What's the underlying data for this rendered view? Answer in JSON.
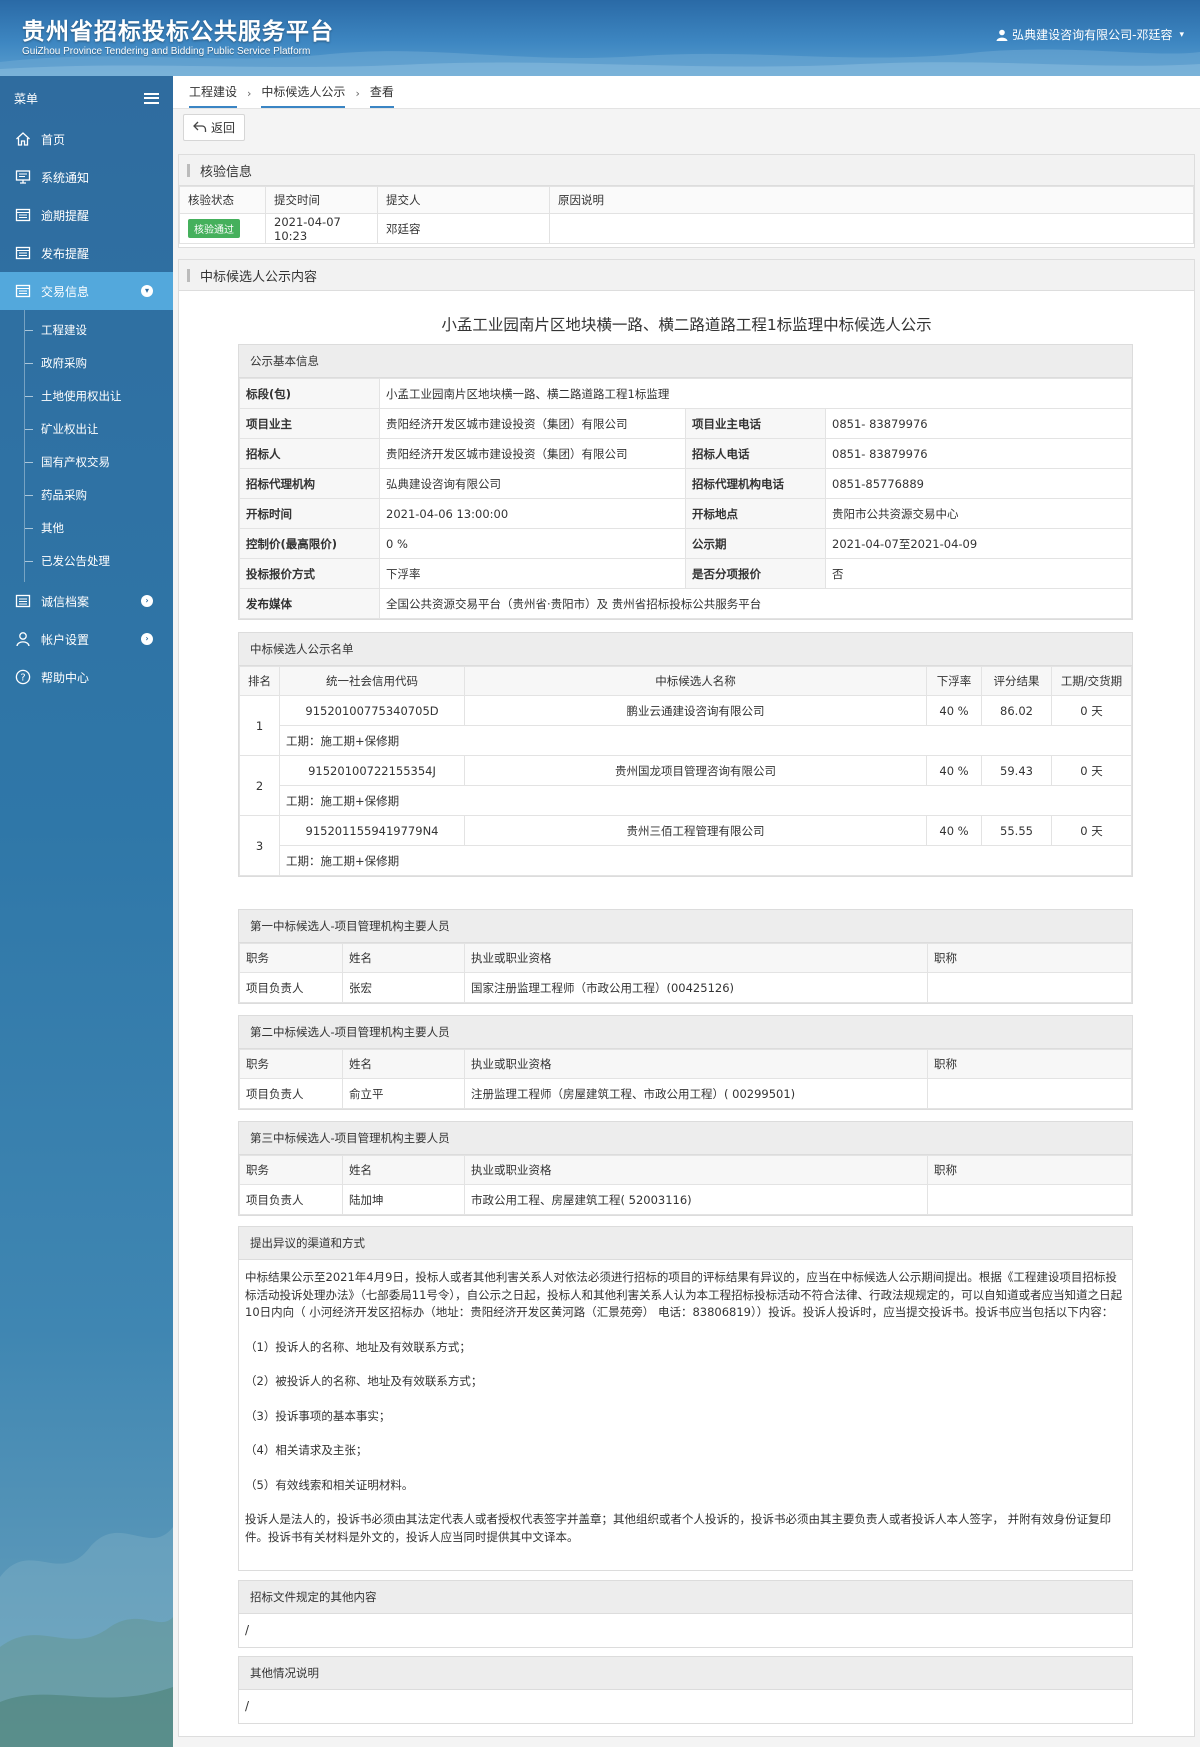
{
  "header": {
    "title": "贵州省招标投标公共服务平台",
    "subtitle": "GuiZhou Province Tendering and Bidding Public Service Platform",
    "user": "弘典建设咨询有限公司-邓廷容"
  },
  "sidebar": {
    "menu_label": "菜单",
    "items": [
      {
        "label": "首页",
        "icon": "home-icon"
      },
      {
        "label": "系统通知",
        "icon": "monitor-icon"
      },
      {
        "label": "逾期提醒",
        "icon": "list-icon"
      },
      {
        "label": "发布提醒",
        "icon": "list-icon"
      },
      {
        "label": "交易信息",
        "icon": "list-icon"
      }
    ],
    "subitems": [
      "工程建设",
      "政府采购",
      "土地使用权出让",
      "矿业权出让",
      "国有产权交易",
      "药品采购",
      "其他",
      "已发公告处理"
    ],
    "items_after": [
      {
        "label": "诚信档案",
        "icon": "list-icon"
      },
      {
        "label": "帐户设置",
        "icon": "user-icon"
      },
      {
        "label": "帮助中心",
        "icon": "help-icon"
      }
    ]
  },
  "breadcrumb": [
    "工程建设",
    "中标候选人公示",
    "查看"
  ],
  "toolbar": {
    "back_label": "返回"
  },
  "verify": {
    "title": "核验信息",
    "headers": [
      "核验状态",
      "提交时间",
      "提交人",
      "原因说明"
    ],
    "status": "核验通过",
    "time": "2021-04-07 10:23",
    "submitter": "邓廷容",
    "reason": ""
  },
  "content": {
    "panel_title": "中标候选人公示内容",
    "notice_title": "小孟工业园南片区地块横一路、横二路道路工程1标监理中标候选人公示",
    "basic": {
      "title": "公示基本信息",
      "section_label": "标段(包)",
      "section_value": "小孟工业园南片区地块横一路、横二路道路工程1标监理",
      "rows": [
        {
          "k1": "项目业主",
          "v1": "贵阳经济开发区城市建设投资（集团）有限公司",
          "k2": "项目业主电话",
          "v2": "0851- 83879976"
        },
        {
          "k1": "招标人",
          "v1": "贵阳经济开发区城市建设投资（集团）有限公司",
          "k2": "招标人电话",
          "v2": "0851- 83879976"
        },
        {
          "k1": "招标代理机构",
          "v1": "弘典建设咨询有限公司",
          "k2": "招标代理机构电话",
          "v2": "0851-85776889"
        },
        {
          "k1": "开标时间",
          "v1": "2021-04-06 13:00:00",
          "k2": "开标地点",
          "v2": "贵阳市公共资源交易中心"
        },
        {
          "k1": "控制价(最高限价)",
          "v1": "0 %",
          "k2": "公示期",
          "v2": "2021-04-07至2021-04-09"
        },
        {
          "k1": "投标报价方式",
          "v1": "下浮率",
          "k2": "是否分项报价",
          "v2": "否"
        }
      ],
      "media_label": "发布媒体",
      "media_value": "全国公共资源交易平台（贵州省·贵阳市）及 贵州省招标投标公共服务平台"
    },
    "candidates": {
      "title": "中标候选人公示名单",
      "headers": [
        "排名",
        "统一社会信用代码",
        "中标候选人名称",
        "下浮率",
        "评分结果",
        "工期/交货期"
      ],
      "rows": [
        {
          "rank": "1",
          "code": "91520100775340705D",
          "name": "鹏业云通建设咨询有限公司",
          "rate": "40 %",
          "score": "86.02",
          "period": "0 天",
          "note": "工期：施工期+保修期"
        },
        {
          "rank": "2",
          "code": "91520100722155354J",
          "name": "贵州国龙项目管理咨询有限公司",
          "rate": "40 %",
          "score": "59.43",
          "period": "0 天",
          "note": "工期：施工期+保修期"
        },
        {
          "rank": "3",
          "code": "9152011559419779N4",
          "name": "贵州三佰工程管理有限公司",
          "rate": "40 %",
          "score": "55.55",
          "period": "0 天",
          "note": "工期：施工期+保修期"
        }
      ]
    },
    "staff_headers": [
      "职务",
      "姓名",
      "执业或职业资格",
      "职称"
    ],
    "staff_blocks": [
      {
        "title": "第一中标候选人-项目管理机构主要人员",
        "role": "项目负责人",
        "name": "张宏",
        "cert": "国家注册监理工程师（市政公用工程）(00425126)",
        "rank": ""
      },
      {
        "title": "第二中标候选人-项目管理机构主要人员",
        "role": "项目负责人",
        "name": "俞立平",
        "cert": "注册监理工程师（房屋建筑工程、市政公用工程）( 00299501)",
        "rank": ""
      },
      {
        "title": "第三中标候选人-项目管理机构主要人员",
        "role": "项目负责人",
        "name": "陆加坤",
        "cert": "市政公用工程、房屋建筑工程( 52003116)",
        "rank": ""
      }
    ],
    "objection": {
      "title": "提出异议的渠道和方式",
      "intro": "中标结果公示至2021年4月9日，投标人或者其他利害关系人对依法必须进行招标的项目的评标结果有异议的，应当在中标候选人公示期间提出。根据《工程建设项目招标投标活动投诉处理办法》（七部委局11号令），自公示之日起，投标人和其他利害关系人认为本工程招标投标活动不符合法律、行政法规规定的，可以自知道或者应当知道之日起10日内向（ 小河经济开发区招标办（地址：贵阳经济开发区黄河路（汇景苑旁） 电话：83806819））投诉。投诉人投诉时，应当提交投诉书。投诉书应当包括以下内容：",
      "items": [
        "（1）投诉人的名称、地址及有效联系方式；",
        "（2）被投诉人的名称、地址及有效联系方式；",
        "（3）投诉事项的基本事实；",
        "（4）相关请求及主张；",
        "（5）有效线索和相关证明材料。"
      ],
      "footer": "投诉人是法人的，投诉书必须由其法定代表人或者授权代表签字并盖章；其他组织或者个人投诉的，投诉书必须由其主要负责人或者投诉人本人签字， 并附有效身份证复印件。投诉书有关材料是外文的，投诉人应当同时提供其中文译本。"
    },
    "other_content": {
      "title": "招标文件规定的其他内容",
      "value": "/"
    },
    "other_notes": {
      "title": "其他情况说明",
      "value": "/"
    }
  }
}
